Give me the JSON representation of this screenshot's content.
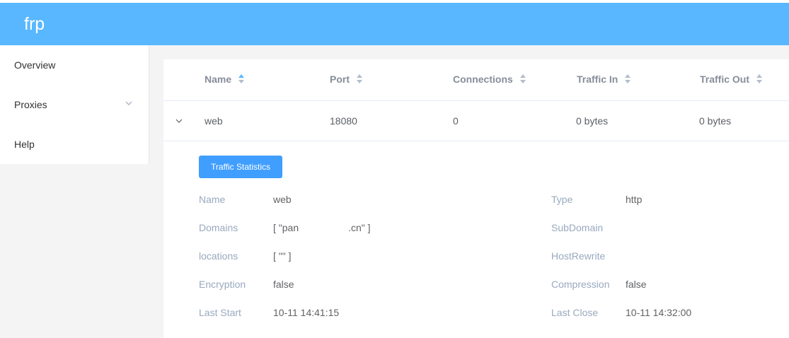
{
  "app": {
    "title": "frp",
    "brand_color": "#58b7ff"
  },
  "sidebar": {
    "items": [
      {
        "label": "Overview",
        "has_submenu": false
      },
      {
        "label": "Proxies",
        "has_submenu": true,
        "icon": "chevron-down-icon"
      },
      {
        "label": "Help",
        "has_submenu": false
      }
    ]
  },
  "table": {
    "columns": [
      {
        "label": "Name",
        "sort_active": true
      },
      {
        "label": "Port",
        "sort_active": false
      },
      {
        "label": "Connections",
        "sort_active": false
      },
      {
        "label": "Traffic In",
        "sort_active": false
      },
      {
        "label": "Traffic Out",
        "sort_active": false
      }
    ],
    "rows": [
      {
        "name": "web",
        "port": "18080",
        "connections": "0",
        "traffic_in": "0 bytes",
        "traffic_out": "0 bytes",
        "expanded": true
      }
    ]
  },
  "details": {
    "button_label": "Traffic Statistics",
    "left": [
      {
        "label": "Name",
        "value": "web"
      },
      {
        "label": "Domains",
        "value": "[ \"pan                  .cn\" ]"
      },
      {
        "label": "locations",
        "value": "[ \"\" ]"
      },
      {
        "label": "Encryption",
        "value": "false"
      },
      {
        "label": "Last Start",
        "value": "10-11 14:41:15"
      }
    ],
    "right": [
      {
        "label": "Type",
        "value": "http"
      },
      {
        "label": "SubDomain",
        "value": ""
      },
      {
        "label": "HostRewrite",
        "value": ""
      },
      {
        "label": "Compression",
        "value": "false"
      },
      {
        "label": "Last Close",
        "value": "10-11 14:32:00"
      }
    ]
  }
}
